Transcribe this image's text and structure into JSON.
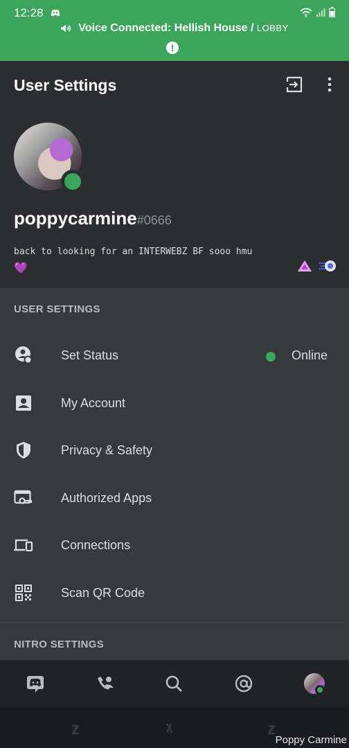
{
  "status_bar": {
    "time": "12:28",
    "icons": [
      "discord-icon",
      "wifi-icon",
      "signal-icon",
      "battery-icon"
    ]
  },
  "voice": {
    "prefix": "Voice Connected: Hellish House /",
    "channel": "LOBBY"
  },
  "header": {
    "title": "User Settings",
    "icons": [
      "logout-icon",
      "more-icon"
    ]
  },
  "profile": {
    "username": "poppycarmine",
    "discriminator": "#0666",
    "bio": "back to looking for an INTERWEBZ B₣ sooo hmu",
    "bio_emoji": "💜",
    "status_color": "#3ba55c",
    "badges": [
      "nitro-badge-icon",
      "boost-badge-icon"
    ]
  },
  "user_settings": {
    "header": "USER SETTINGS",
    "items": [
      {
        "label": "Set Status",
        "icon": "status-icon",
        "value": "Online"
      },
      {
        "label": "My Account",
        "icon": "account-icon"
      },
      {
        "label": "Privacy & Safety",
        "icon": "shield-icon"
      },
      {
        "label": "Authorized Apps",
        "icon": "apps-key-icon"
      },
      {
        "label": "Connections",
        "icon": "devices-icon"
      },
      {
        "label": "Scan QR Code",
        "icon": "qr-code-icon"
      }
    ]
  },
  "nitro_settings": {
    "header": "NITRO SETTINGS"
  },
  "bottom_nav": {
    "items": [
      "discord-home-icon",
      "friends-icon",
      "search-icon",
      "mentions-icon",
      "profile-avatar"
    ]
  },
  "watermark": "Poppy Carmine",
  "colors": {
    "banner": "#3ba55c",
    "profile_bg": "#2b2d31",
    "settings_bg": "#36393f",
    "nav_bg": "#202225",
    "online": "#3ba55c"
  }
}
